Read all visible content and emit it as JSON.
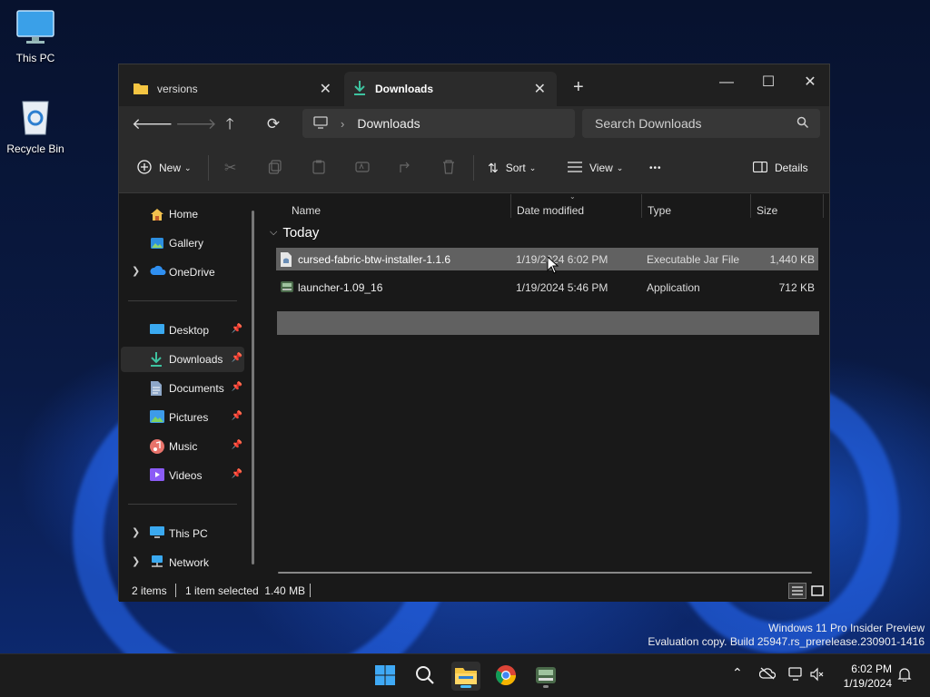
{
  "desktop": {
    "icons": [
      {
        "label": "This PC"
      },
      {
        "label": "Recycle Bin"
      }
    ],
    "watermark": {
      "line1": "Windows 11 Pro Insider Preview",
      "line2": "Evaluation copy. Build 25947.rs_prerelease.230901-1416"
    }
  },
  "window": {
    "tabs": [
      {
        "label": "versions",
        "icon": "folder-icon",
        "close": "✕"
      },
      {
        "label": "Downloads",
        "icon": "download-icon",
        "close": "✕"
      }
    ],
    "new_tab": "+",
    "controls": {
      "minimize": "—",
      "maximize": "☐",
      "close": "✕"
    },
    "address": {
      "location": "Downloads"
    },
    "search": {
      "placeholder": "Search Downloads"
    },
    "toolbar": {
      "new_label": "New",
      "sort_label": "Sort",
      "view_label": "View",
      "more_label": "•••",
      "details_label": "Details"
    },
    "sidebar": {
      "items": [
        {
          "label": "Home",
          "icon": "home-icon"
        },
        {
          "label": "Gallery",
          "icon": "gallery-icon"
        },
        {
          "label": "OneDrive",
          "icon": "cloud-icon"
        },
        {
          "label": "Desktop",
          "icon": "desktop-icon"
        },
        {
          "label": "Downloads",
          "icon": "download-icon"
        },
        {
          "label": "Documents",
          "icon": "document-icon"
        },
        {
          "label": "Pictures",
          "icon": "pictures-icon"
        },
        {
          "label": "Music",
          "icon": "music-icon"
        },
        {
          "label": "Videos",
          "icon": "videos-icon"
        },
        {
          "label": "This PC",
          "icon": "pc-icon"
        },
        {
          "label": "Network",
          "icon": "network-icon"
        }
      ]
    },
    "columns": {
      "name": "Name",
      "date": "Date modified",
      "type": "Type",
      "size": "Size"
    },
    "group": "Today",
    "files": [
      {
        "name": "cursed-fabric-btw-installer-1.1.6",
        "date": "1/19/2024 6:02 PM",
        "type": "Executable Jar File",
        "size": "1,440 KB"
      },
      {
        "name": "launcher-1.09_16",
        "date": "1/19/2024 5:46 PM",
        "type": "Application",
        "size": "712 KB"
      }
    ],
    "status": {
      "count": "2 items",
      "selection": "1 item selected  1.40 MB"
    }
  },
  "taskbar": {
    "clock": {
      "time": "6:02 PM",
      "date": "1/19/2024"
    }
  },
  "colors": {
    "accent": "#4cc2ff",
    "selected_row": "#616161",
    "download_green": "#3ec3a0"
  }
}
